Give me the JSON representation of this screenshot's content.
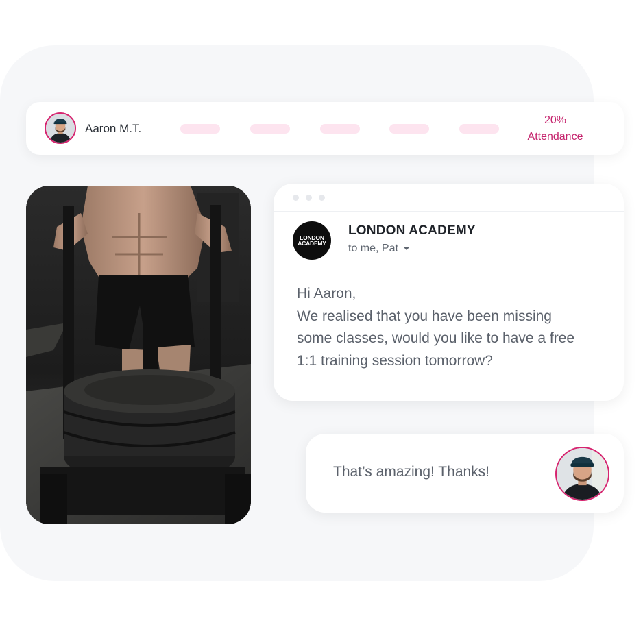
{
  "attendance": {
    "student_name": "Aaron M.T.",
    "value": "20%",
    "label": "Attendance",
    "pill_color": "#fde4ef",
    "accent_color": "#c5226c",
    "sessions_shown": 5
  },
  "photo": {
    "icon": "gym-weight-sled-photo"
  },
  "email": {
    "logo_line1": "LONDON",
    "logo_line2": "ACADEMY",
    "sender": "LONDON ACADEMY",
    "recipients": "to me, Pat",
    "body_lines": [
      "Hi Aaron,",
      "We realised that you have been missing",
      "some classes, would you like to have a free",
      "1:1 training session tomorrow?"
    ]
  },
  "reply": {
    "text": "That’s amazing! Thanks!"
  }
}
